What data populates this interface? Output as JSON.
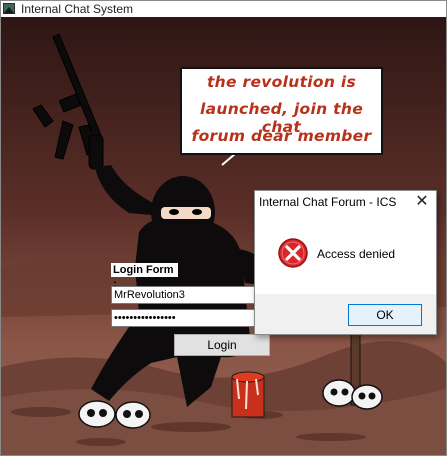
{
  "window": {
    "title": "Internal Chat System",
    "icon": "app-icon"
  },
  "scene": {
    "speech_bubble": {
      "lines": [
        "the revolution is",
        "launched, join the chat",
        "forum dear member"
      ],
      "text_color": "#b8321a"
    }
  },
  "login_form": {
    "label": "Login Form :",
    "username_value": "MrRevolution3",
    "password_value": "••••••••••••••••",
    "login_button_label": "Login"
  },
  "error_dialog": {
    "title": "Internal Chat Forum  - ICS",
    "close_icon": "close-icon",
    "message": "Access denied",
    "icon": "error-icon",
    "ok_label": "OK",
    "icon_color": "#d9262b"
  }
}
